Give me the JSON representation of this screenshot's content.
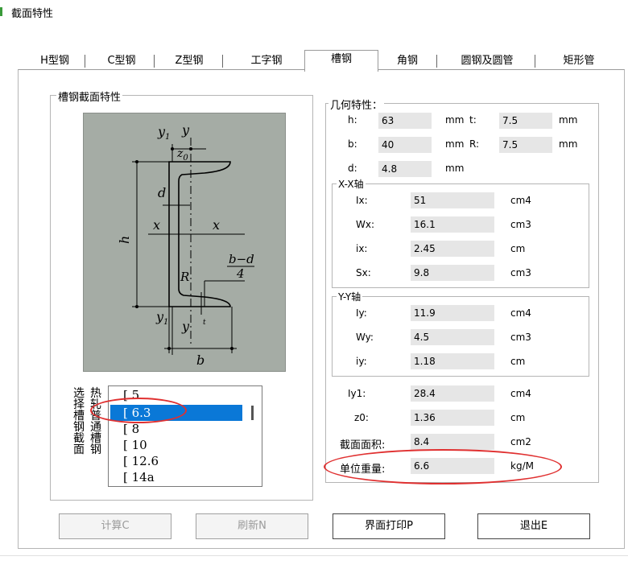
{
  "window": {
    "title": "截面特性"
  },
  "tabs": [
    {
      "label": "H型钢"
    },
    {
      "label": "C型钢"
    },
    {
      "label": "Z型钢"
    },
    {
      "label": "工字钢"
    },
    {
      "label": "槽钢"
    },
    {
      "label": "角钢"
    },
    {
      "label": "圆钢及圆管"
    },
    {
      "label": "矩形管"
    }
  ],
  "section_group": {
    "title": "槽钢截面特性"
  },
  "diagram": {
    "y1_top": "y",
    "y1_top_sub": "1",
    "y_top": "y",
    "z0": "z",
    "z0_sub": "0",
    "d": "d",
    "x_left": "x",
    "x_right": "x",
    "h": "h",
    "frac_num": "b−d",
    "frac_den": "4",
    "R": "R",
    "y1_bot": "y",
    "y1_bot_sub": "1",
    "y_bot": "y",
    "t": "t",
    "b": "b"
  },
  "selector": {
    "label": "选择槽钢截面",
    "label2": "热轧普通槽钢",
    "items": [
      "[ 5",
      "[ 6.3",
      "[ 8",
      "[ 10",
      "[ 12.6",
      "[ 14a"
    ]
  },
  "geometry": {
    "title": "几何特性：",
    "h_label": "h:",
    "h_value": "63",
    "h_unit": "mm",
    "t_label": "t:",
    "t_value": "7.5",
    "t_unit": "mm",
    "b_label": "b:",
    "b_value": "40",
    "b_unit": "mm",
    "R_label": "R:",
    "R_value": "7.5",
    "R_unit": "mm",
    "d_label": "d:",
    "d_value": "4.8",
    "d_unit": "mm"
  },
  "xx_axis": {
    "title": "X-X轴",
    "rows": [
      {
        "label": "Ix:",
        "value": "51",
        "unit": "cm4"
      },
      {
        "label": "Wx:",
        "value": "16.1",
        "unit": "cm3"
      },
      {
        "label": "ix:",
        "value": "2.45",
        "unit": "cm"
      },
      {
        "label": "Sx:",
        "value": "9.8",
        "unit": "cm3"
      }
    ]
  },
  "yy_axis": {
    "title": "Y-Y轴",
    "rows": [
      {
        "label": "Iy:",
        "value": "11.9",
        "unit": "cm4"
      },
      {
        "label": "Wy:",
        "value": "4.5",
        "unit": "cm3"
      },
      {
        "label": "iy:",
        "value": "1.18",
        "unit": "cm"
      }
    ]
  },
  "extra": [
    {
      "label": "Iy1:",
      "value": "28.4",
      "unit": "cm4"
    },
    {
      "label": "z0:",
      "value": "1.36",
      "unit": "cm"
    },
    {
      "label": "截面面积:",
      "value": "8.4",
      "unit": "cm2"
    },
    {
      "label": "单位重量:",
      "value": "6.6",
      "unit": "kg/M"
    }
  ],
  "buttons": {
    "calc": "计算C",
    "refresh": "刷新N",
    "print": "界面打印P",
    "exit": "退出E"
  },
  "colors": {
    "selection": "#0a78d7",
    "annotation": "#e03030"
  }
}
